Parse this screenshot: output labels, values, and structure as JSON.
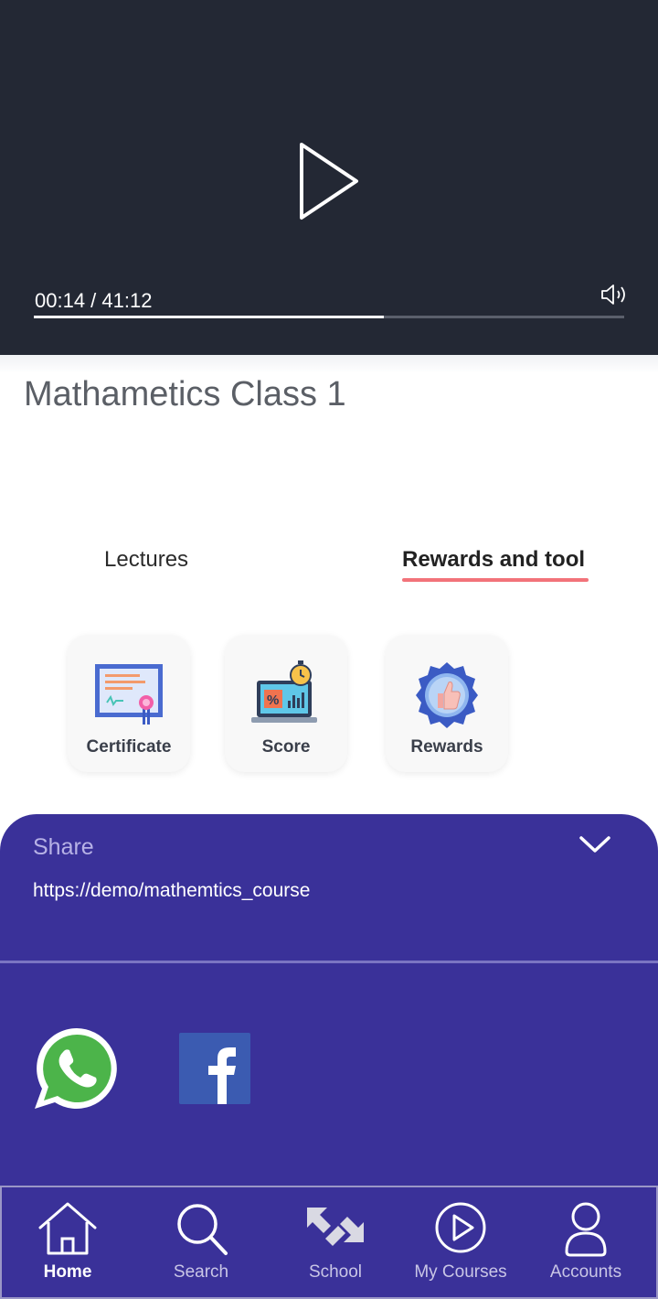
{
  "player": {
    "time_display": "00:14 / 41:12",
    "progress": 0.593,
    "icons": [
      "play-icon",
      "volume-icon"
    ]
  },
  "course": {
    "title": "Mathametics Class 1"
  },
  "tabs": [
    {
      "label": "Lectures",
      "active": false
    },
    {
      "label": "Rewards and tool",
      "active": true
    }
  ],
  "tools": [
    {
      "label": "Certificate",
      "icon": "certificate-icon"
    },
    {
      "label": "Score",
      "icon": "score-icon"
    },
    {
      "label": "Rewards",
      "icon": "rewards-badge-icon"
    }
  ],
  "share": {
    "title": "Share",
    "url": "https://demo/mathemtics_course",
    "apps": [
      "whatsapp-icon",
      "facebook-icon"
    ]
  },
  "nav": [
    {
      "label": "Home",
      "icon": "home-icon",
      "active": true
    },
    {
      "label": "Search",
      "icon": "search-icon",
      "active": false
    },
    {
      "label": "School",
      "icon": "school-icon",
      "active": false
    },
    {
      "label": "My Courses",
      "icon": "play-circle-icon",
      "active": false
    },
    {
      "label": "Accounts",
      "icon": "user-icon",
      "active": false
    }
  ],
  "colors": {
    "player_bg": "#232834",
    "panel_bg": "#3a3199",
    "accent_underline": "#f2737a"
  }
}
